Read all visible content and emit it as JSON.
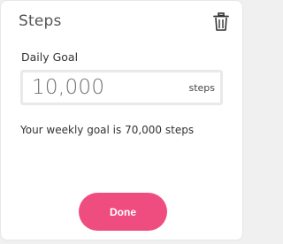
{
  "dialog": {
    "title": "Steps",
    "delete_icon": "trash-icon",
    "goal_label": "Daily Goal",
    "goal_value": "10,000",
    "goal_unit": "steps",
    "summary": "Your weekly goal is 70,000 steps",
    "done_label": "Done"
  },
  "colors": {
    "accent": "#ef4d7f",
    "title_text": "#555555",
    "body_text": "#333333",
    "input_border": "#e9e9e9"
  }
}
